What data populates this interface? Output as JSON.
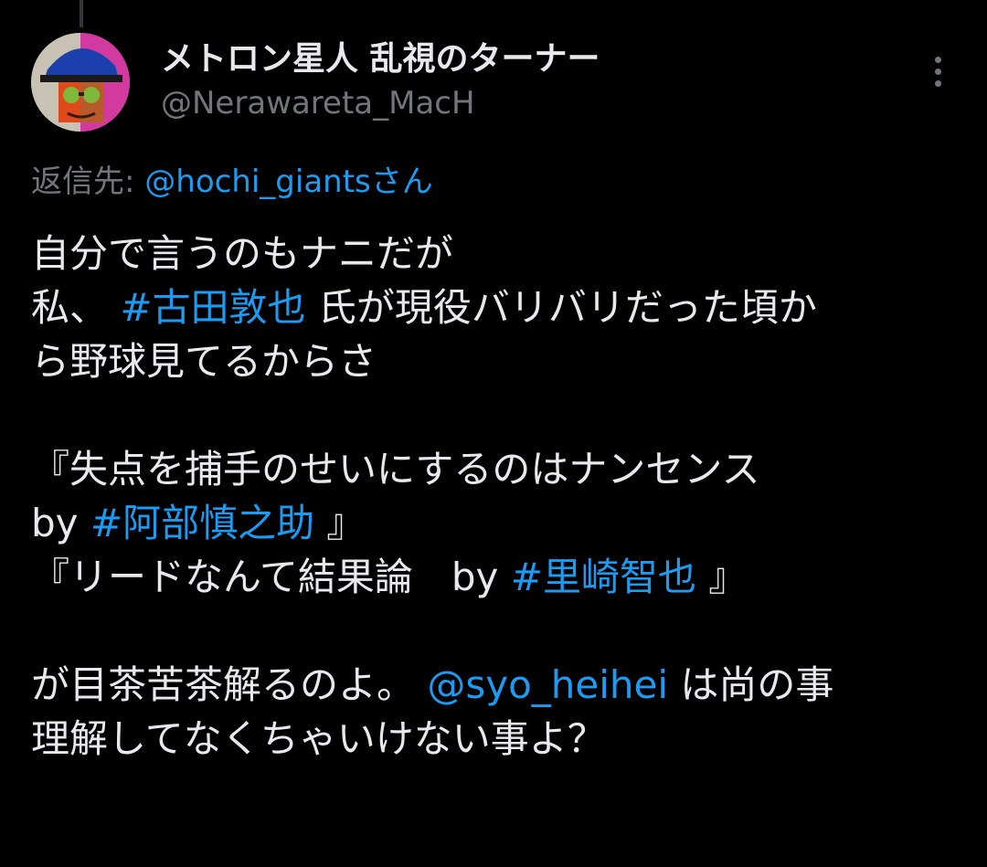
{
  "author": {
    "display_name": "メトロン星人 乱視のターナー",
    "handle": "@Nerawareta_MacH"
  },
  "icons": {
    "avatar": "avatar-image",
    "more": "more-options-icon"
  },
  "reply_to": {
    "label": "返信先: ",
    "mention": "@hochi_giants",
    "suffix": "さん"
  },
  "tweet": {
    "line1": "自分で言うのもナニだが",
    "line2_pre": "私、 ",
    "line2_tag": "#古田敦也",
    "line2_post": " 氏が現役バリバリだった頃か",
    "line3": "ら野球見てるからさ",
    "quote1_a": "『失点を捕手のせいにするのはナンセンス",
    "quote1_b_pre": "by ",
    "quote1_b_tag": "#阿部慎之助",
    "quote1_b_post": " 』",
    "quote2_pre": "『リードなんて結果論　by ",
    "quote2_tag": "#里崎智也",
    "quote2_post": " 』",
    "closing1_pre": "が目茶苦茶解るのよ。 ",
    "closing1_mention": "@syo_heihei",
    "closing1_post": " は尚の事",
    "closing2": "理解してなくちゃいけない事よ？"
  },
  "colors": {
    "background": "#000000",
    "text": "#e7e9ea",
    "secondary": "#71767b",
    "link": "#1d9bf0"
  }
}
